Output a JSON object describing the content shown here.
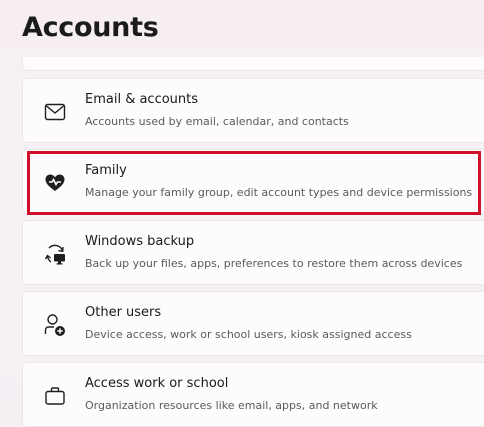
{
  "page": {
    "title": "Accounts"
  },
  "items": [
    {
      "title": "Email & accounts",
      "subtitle": "Accounts used by email, calendar, and contacts",
      "icon": "mail-icon"
    },
    {
      "title": "Family",
      "subtitle": "Manage your family group, edit account types and device permissions",
      "icon": "family-heart-icon"
    },
    {
      "title": "Windows backup",
      "subtitle": "Back up your files, apps, preferences to restore them across devices",
      "icon": "backup-icon"
    },
    {
      "title": "Other users",
      "subtitle": "Device access, work or school users, kiosk assigned access",
      "icon": "add-user-icon"
    },
    {
      "title": "Access work or school",
      "subtitle": "Organization resources like email, apps, and network",
      "icon": "briefcase-icon"
    }
  ],
  "highlight": {
    "color": "#d0102a",
    "target": "Family"
  }
}
